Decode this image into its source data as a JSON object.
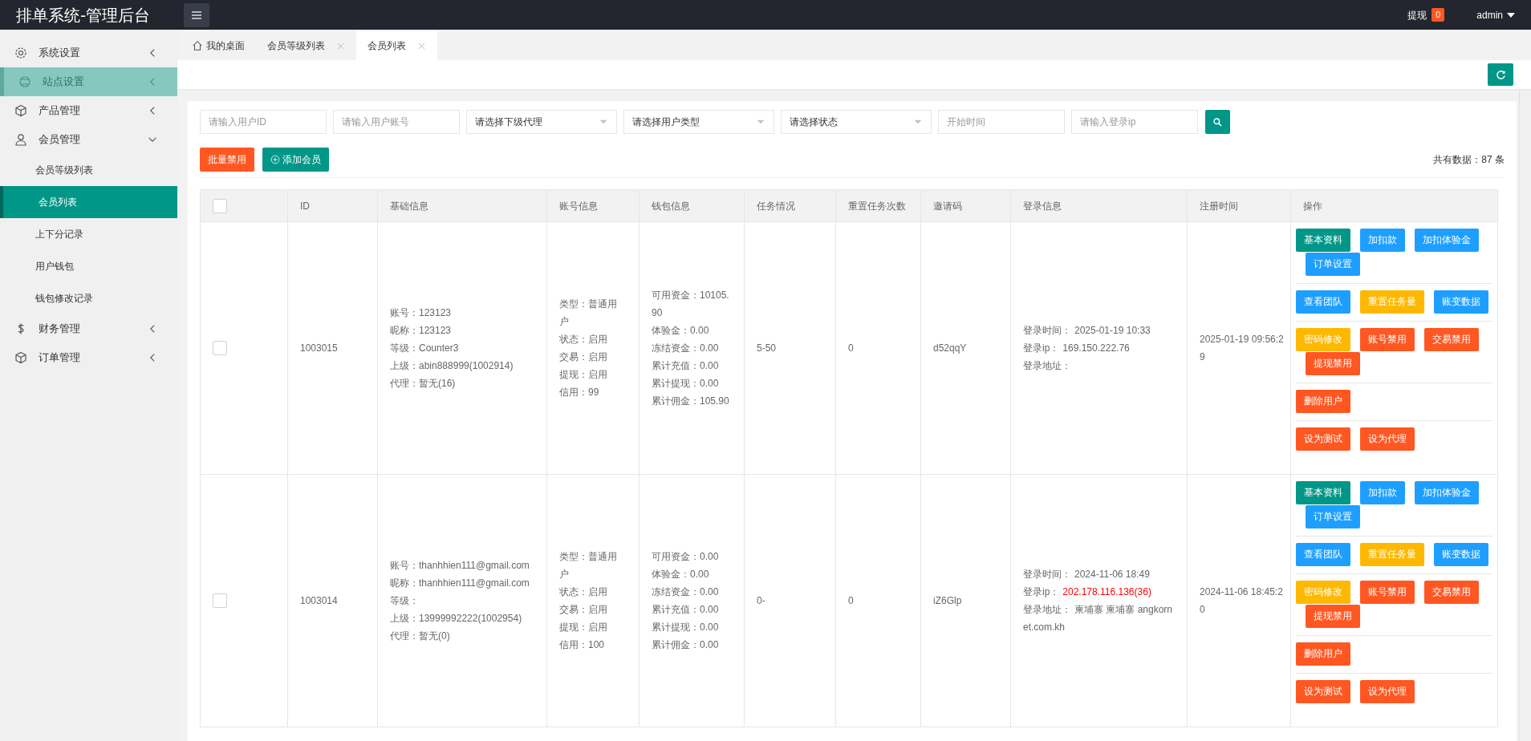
{
  "header": {
    "title": "排单系统-管理后台",
    "withdraw_label": "提现",
    "withdraw_count": "0",
    "user": "admin"
  },
  "sidebar": {
    "items": [
      {
        "label": "系统设置",
        "kind": "gear",
        "expanded": false,
        "highlighted": false
      },
      {
        "label": "站点设置",
        "kind": "globe",
        "expanded": false,
        "highlighted": true
      },
      {
        "label": "产品管理",
        "kind": "box",
        "expanded": false,
        "highlighted": false
      },
      {
        "label": "会员管理",
        "kind": "user",
        "expanded": true,
        "highlighted": false,
        "children": [
          {
            "label": "会员等级列表",
            "selected": false
          },
          {
            "label": "会员列表",
            "selected": true
          },
          {
            "label": "上下分记录",
            "selected": false
          },
          {
            "label": "用户钱包",
            "selected": false
          },
          {
            "label": "钱包修改记录",
            "selected": false
          }
        ]
      },
      {
        "label": "财务管理",
        "kind": "dollar",
        "expanded": false,
        "highlighted": false
      },
      {
        "label": "订单管理",
        "kind": "box",
        "expanded": false,
        "highlighted": false
      }
    ]
  },
  "tabs": [
    {
      "label": "我的桌面",
      "kind": "home",
      "closable": false,
      "selected": false
    },
    {
      "label": "会员等级列表",
      "kind": "page",
      "closable": true,
      "selected": false
    },
    {
      "label": "会员列表",
      "kind": "page",
      "closable": true,
      "selected": true
    }
  ],
  "filters": [
    {
      "kind": "input",
      "placeholder": "请输入用户ID"
    },
    {
      "kind": "input",
      "placeholder": "请输入用户账号"
    },
    {
      "kind": "select",
      "value": "请选择下级代理"
    },
    {
      "kind": "select",
      "value": "请选择用户类型"
    },
    {
      "kind": "select",
      "value": "请选择状态"
    },
    {
      "kind": "input",
      "placeholder": "开始时间"
    },
    {
      "kind": "input",
      "placeholder": "请输入登录ip"
    }
  ],
  "toolbar": {
    "buttons": [
      {
        "label": "批量禁用",
        "kind": "danger",
        "icon": false
      },
      {
        "label": "添加会员",
        "kind": "primary",
        "icon": true
      }
    ],
    "total": "共有数据：87 条"
  },
  "table": {
    "header_checked": false,
    "columns": [
      "ID",
      "基础信息",
      "账号信息",
      "钱包信息",
      "任务情况",
      "重置任务次数",
      "邀请码",
      "登录信息",
      "注册时间",
      "操作"
    ],
    "rows": [
      {
        "checked": false,
        "id": "1003015",
        "basic": [
          "账号：123123",
          "昵称：123123",
          "等级：Counter3",
          "上级：abin888999(1002914)",
          "代理：暂无(16)"
        ],
        "account": [
          "类型：普通用户",
          "状态：启用",
          "交易：启用",
          "提现：启用",
          "信用：99"
        ],
        "wallet": [
          "可用资金：10105.90",
          "体验金：0.00",
          "冻结资金：0.00",
          "累计充值：0.00",
          "累计提现：0.00",
          "累计佣金：105.90"
        ],
        "task": "5-50",
        "reset_count": "0",
        "invite_code": "d52qqY",
        "login": [
          {
            "label": "登录时间：",
            "value": "2025-01-19 10:33",
            "alert": false
          },
          {
            "label": "登录ip：",
            "value": "169.150.222.76",
            "alert": false
          },
          {
            "label": "登录地址：",
            "alert": false
          }
        ],
        "register_time": "2025-01-19 09:56:29",
        "actions": [
          [
            {
              "label": "基本资料",
              "kind": "primary"
            },
            {
              "label": "加扣款",
              "kind": "normal"
            },
            {
              "label": "加扣体验金",
              "kind": "normal"
            },
            {
              "label": "订单设置",
              "kind": "normal"
            }
          ],
          [
            {
              "label": "查看团队",
              "kind": "normal"
            },
            {
              "label": "重置任务量",
              "kind": "warm"
            },
            {
              "label": "账变数据",
              "kind": "normal"
            }
          ],
          [
            {
              "label": "密码修改",
              "kind": "warm"
            },
            {
              "label": "账号禁用",
              "kind": "danger"
            },
            {
              "label": "交易禁用",
              "kind": "danger"
            },
            {
              "label": "提现禁用",
              "kind": "danger"
            }
          ],
          [
            {
              "label": "删除用户",
              "kind": "danger"
            }
          ],
          [
            {
              "label": "设为测试",
              "kind": "danger"
            },
            {
              "label": "设为代理",
              "kind": "danger"
            }
          ]
        ]
      },
      {
        "checked": false,
        "id": "1003014",
        "basic": [
          "账号：thanhhien111@gmail.com",
          "昵称：thanhhien111@gmail.com",
          "等级：",
          "上级：13999992222(1002954)",
          "代理：暂无(0)"
        ],
        "account": [
          "类型：普通用户",
          "状态：启用",
          "交易：启用",
          "提现：启用",
          "信用：100"
        ],
        "wallet": [
          "可用资金：0.00",
          "体验金：0.00",
          "冻结资金：0.00",
          "累计充值：0.00",
          "累计提现：0.00",
          "累计佣金：0.00"
        ],
        "task": "0-",
        "reset_count": "0",
        "invite_code": "iZ6Glp",
        "login": [
          {
            "label": "登录时间：",
            "value": "2024-11-06 18:49",
            "alert": false
          },
          {
            "label": "登录ip：",
            "value": "202.178.116.136(36)",
            "alert": true
          },
          {
            "label": "登录地址：",
            "value": "柬埔寨 柬埔寨 angkornet.com.kh",
            "alert": false
          }
        ],
        "register_time": "2024-11-06 18:45:20",
        "actions": [
          [
            {
              "label": "基本资料",
              "kind": "primary"
            },
            {
              "label": "加扣款",
              "kind": "normal"
            },
            {
              "label": "加扣体验金",
              "kind": "normal"
            },
            {
              "label": "订单设置",
              "kind": "normal"
            }
          ],
          [
            {
              "label": "查看团队",
              "kind": "normal"
            },
            {
              "label": "重置任务量",
              "kind": "warm"
            },
            {
              "label": "账变数据",
              "kind": "normal"
            }
          ],
          [
            {
              "label": "密码修改",
              "kind": "warm"
            },
            {
              "label": "账号禁用",
              "kind": "danger"
            },
            {
              "label": "交易禁用",
              "kind": "danger"
            },
            {
              "label": "提现禁用",
              "kind": "danger"
            }
          ],
          [
            {
              "label": "删除用户",
              "kind": "danger"
            }
          ],
          [
            {
              "label": "设为测试",
              "kind": "danger"
            },
            {
              "label": "设为代理",
              "kind": "danger"
            }
          ]
        ]
      }
    ]
  }
}
